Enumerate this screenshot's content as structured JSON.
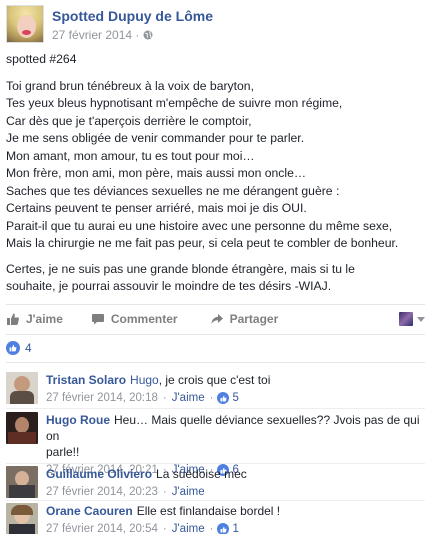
{
  "post": {
    "page_name": "Spotted Dupuy de Lôme",
    "date": "27 février 2014 ·",
    "title": "spotted #264",
    "poem": [
      "Toi grand brun ténébreux à la voix de baryton,",
      "Tes yeux bleus hypnotisant m'empêche de suivre mon régime,",
      "Car dès que je t'aperçois derrière le comptoir,",
      "Je me sens obligée de venir commander pour te parler.",
      "Mon amant, mon amour, tu es tout pour moi…",
      "Mon frère, mon ami, mon père, mais aussi mon oncle…",
      "Saches que tes déviances sexuelles ne me dérangent guère :",
      "Certains peuvent te penser arriéré, mais moi je dis OUI.",
      "Parait-il que tu aurai eu une histoire avec une personne du même sexe,",
      "Mais la chirurgie ne me fait pas peur, si cela peut te combler de bonheur."
    ],
    "closing": [
      "Certes, je ne suis pas une grande blonde étrangère, mais si tu le",
      "souhaite, je pourrai assouvir le moindre de tes désirs -WIAJ."
    ]
  },
  "actions": {
    "like": "J'aime",
    "comment": "Commenter",
    "share": "Partager"
  },
  "reactions": {
    "count": "4"
  },
  "comments": [
    {
      "name": "Tristan Solaro",
      "mention": "Hugo",
      "text": ", je crois que c'est toi",
      "date": "27 février 2014, 20:18",
      "like_label": "J'aime",
      "likes": "5"
    },
    {
      "name": "Hugo Roue",
      "text_line1": "Heu… Mais quelle déviance sexuelles?? Jvois pas de qui on",
      "text_line2": "parle!!",
      "date": "27 février 2014, 20:21",
      "like_label": "J'aime",
      "likes": "6"
    },
    {
      "name": "Guillaume Oliviero",
      "text": "La suédoise mec",
      "date": "27 février 2014, 20:23",
      "like_label": "J'aime"
    },
    {
      "name": "Orane Caouren",
      "text": "Elle est finlandaise bordel !",
      "date": "27 février 2014, 20:54",
      "like_label": "J'aime",
      "likes": "1"
    }
  ],
  "colors": {
    "link": "#365899",
    "meta": "#90949c",
    "like_blue": "#4f7fe0"
  }
}
